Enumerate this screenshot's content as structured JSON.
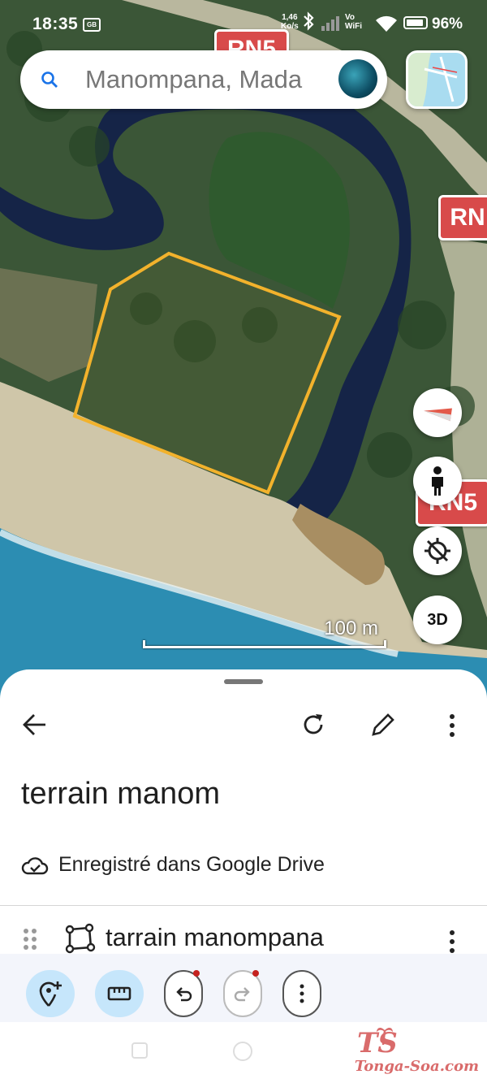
{
  "status_bar": {
    "time": "18:35",
    "net_badge": "GB",
    "speed_value": "1,46",
    "speed_unit": "Ko/s",
    "vowifi_top": "Vo",
    "vowifi_bottom": "WiFi",
    "battery": "96%"
  },
  "search": {
    "text": "Manompana, Mada",
    "icon": "search-icon"
  },
  "map": {
    "road_sign_1": "RN5",
    "road_sign_2": "RN",
    "road_sign_3": "RN5",
    "scale_label": "100 m",
    "polygon_color": "#f2b22c",
    "buttons": {
      "compass": "compass-icon",
      "street_view": "pegman-icon",
      "location": "location-off-icon",
      "three_d": "3D"
    }
  },
  "sheet": {
    "title": "terrain manom",
    "saved_text": "Enregistré dans Google Drive",
    "item_label": "tarrain manompana",
    "accent": "#c6e6fb"
  },
  "watermark": {
    "logo": "TS",
    "site": "Tonga-Soa.com"
  }
}
